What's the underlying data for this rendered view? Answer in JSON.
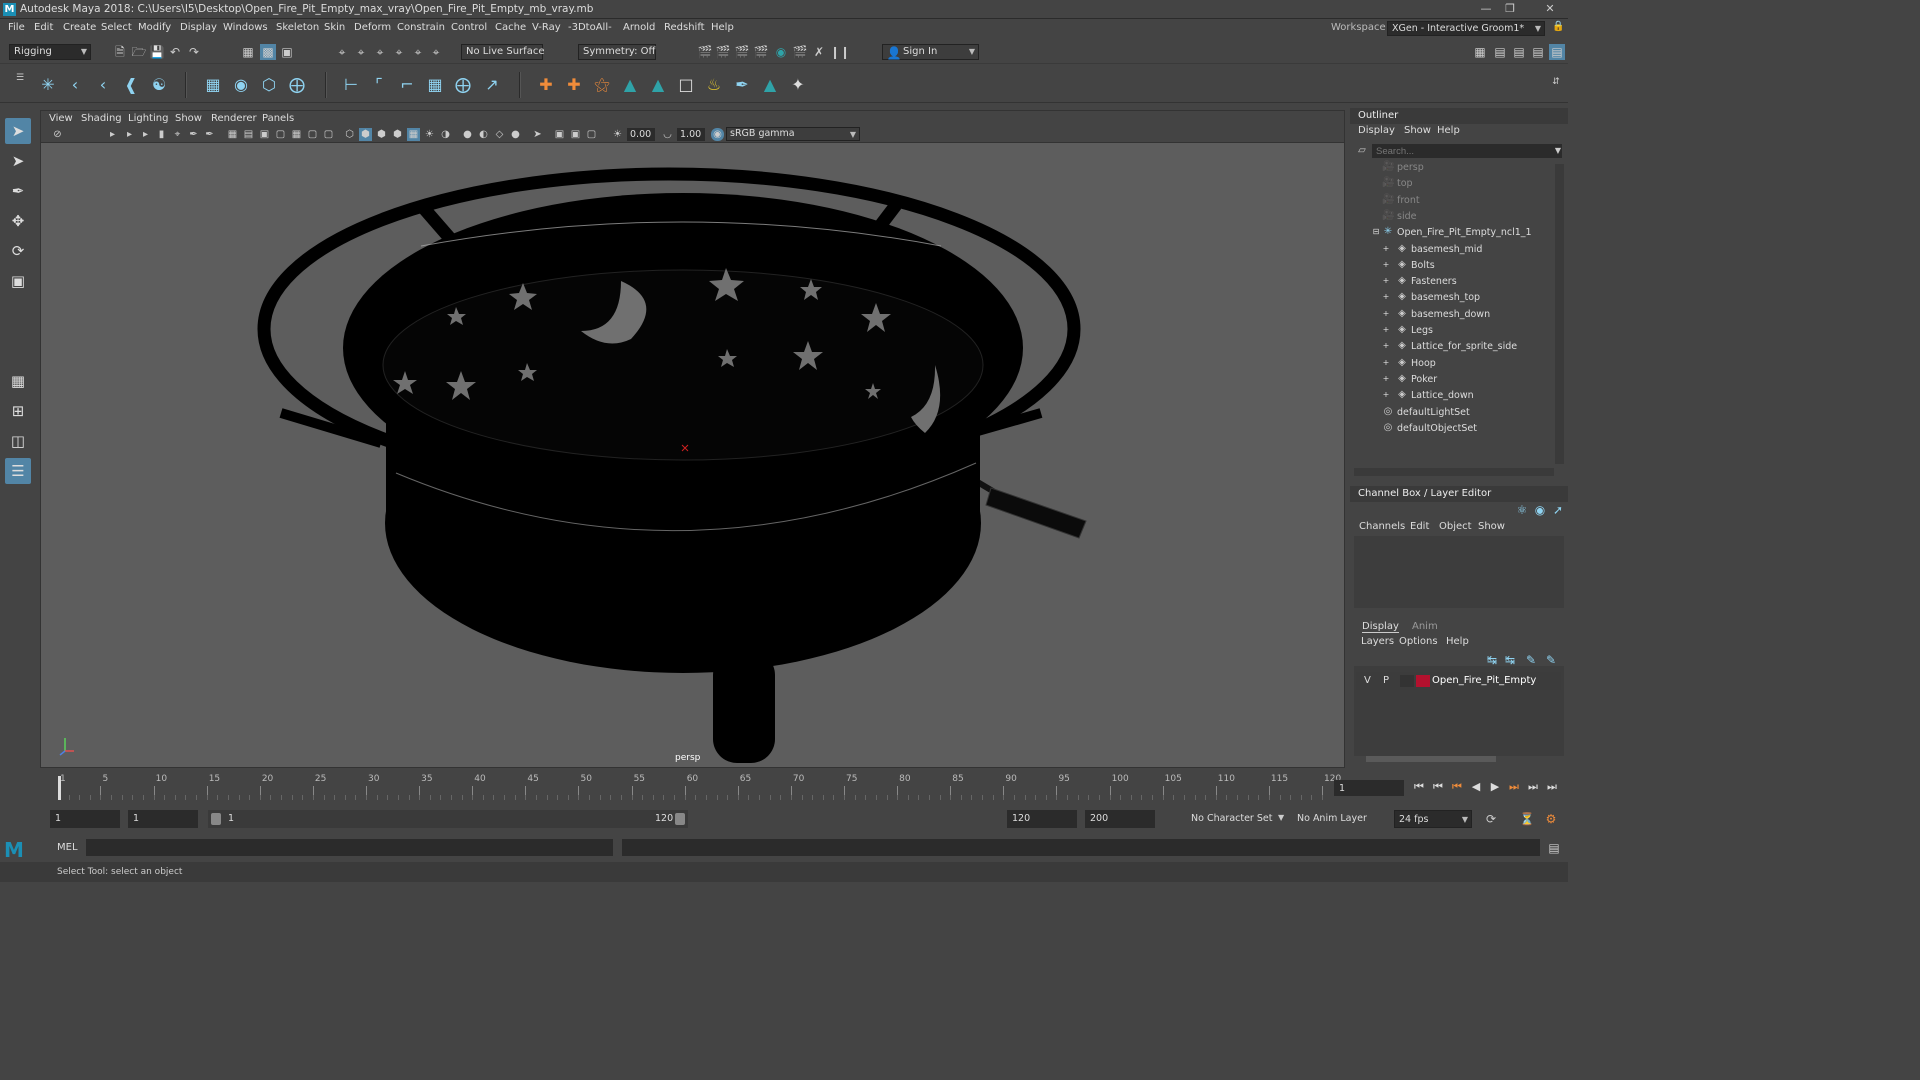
{
  "window": {
    "title": "Autodesk Maya 2018: C:\\Users\\I5\\Desktop\\Open_Fire_Pit_Empty_max_vray\\Open_Fire_Pit_Empty_mb_vray.mb",
    "logo": "M"
  },
  "menu": [
    "File",
    "Edit",
    "Create",
    "Select",
    "Modify",
    "Display",
    "Windows",
    "Skeleton",
    "Skin",
    "Deform",
    "Constrain",
    "Control",
    "Cache",
    "V-Ray",
    "-3DtoAll-",
    "Arnold",
    "Redshift",
    "Help"
  ],
  "workspace": {
    "label": "Workspace :",
    "value": "XGen - Interactive Groom1*"
  },
  "status": {
    "menuset": "Rigging",
    "live_surface": "No Live Surface",
    "symmetry": "Symmetry: Off",
    "sign_in": "Sign In"
  },
  "viewport": {
    "menu": [
      "View",
      "Shading",
      "Lighting",
      "Show",
      "Renderer",
      "Panels"
    ],
    "exposure": "0.00",
    "gamma": "1.00",
    "color_space": "sRGB gamma",
    "camera": "persp"
  },
  "outliner": {
    "title": "Outliner",
    "menu": [
      "Display",
      "Show",
      "Help"
    ],
    "search_placeholder": "Search...",
    "items": [
      {
        "label": "persp",
        "kind": "camera",
        "dim": true
      },
      {
        "label": "top",
        "kind": "camera",
        "dim": true
      },
      {
        "label": "front",
        "kind": "camera",
        "dim": true
      },
      {
        "label": "side",
        "kind": "camera",
        "dim": true
      },
      {
        "label": "Open_Fire_Pit_Empty_ncl1_1",
        "kind": "group",
        "dim": false
      },
      {
        "label": "basemesh_mid",
        "kind": "mesh",
        "dim": false
      },
      {
        "label": "Bolts",
        "kind": "mesh",
        "dim": false
      },
      {
        "label": "Fasteners",
        "kind": "mesh",
        "dim": false
      },
      {
        "label": "basemesh_top",
        "kind": "mesh",
        "dim": false
      },
      {
        "label": "basemesh_down",
        "kind": "mesh",
        "dim": false
      },
      {
        "label": "Legs",
        "kind": "mesh",
        "dim": false
      },
      {
        "label": "Lattice_for_sprite_side",
        "kind": "mesh",
        "dim": false
      },
      {
        "label": "Hoop",
        "kind": "mesh",
        "dim": false
      },
      {
        "label": "Poker",
        "kind": "mesh",
        "dim": false
      },
      {
        "label": "Lattice_down",
        "kind": "mesh",
        "dim": false
      },
      {
        "label": "defaultLightSet",
        "kind": "set",
        "dim": false
      },
      {
        "label": "defaultObjectSet",
        "kind": "set",
        "dim": false
      }
    ]
  },
  "channelbox": {
    "title": "Channel Box / Layer Editor",
    "menu": [
      "Channels",
      "Edit",
      "Object",
      "Show"
    ],
    "tabs": [
      "Display",
      "Anim"
    ],
    "layer_menu": [
      "Layers",
      "Options",
      "Help"
    ],
    "layer": {
      "v": "V",
      "p": "P",
      "name": "Open_Fire_Pit_Empty",
      "color": "#b3112e"
    }
  },
  "timeline": {
    "ticks": [
      "1",
      "5",
      "10",
      "15",
      "20",
      "25",
      "30",
      "35",
      "40",
      "45",
      "50",
      "55",
      "60",
      "65",
      "70",
      "75",
      "80",
      "85",
      "90",
      "95",
      "100",
      "105",
      "110",
      "115",
      "120"
    ],
    "current_frame": "1"
  },
  "range": {
    "start": "1",
    "playback_start": "1",
    "slider_start": "1",
    "slider_end": "120",
    "playback_end": "120",
    "end": "200",
    "character_set": "No Character Set",
    "anim_layer": "No Anim Layer",
    "fps": "24 fps"
  },
  "command": {
    "label": "MEL"
  },
  "help": {
    "text": "Select Tool: select an object"
  },
  "colors": {
    "accent": "#5285a6",
    "shelf_blue": "#8fd3f1",
    "shelf_orange": "#f08c3a"
  }
}
